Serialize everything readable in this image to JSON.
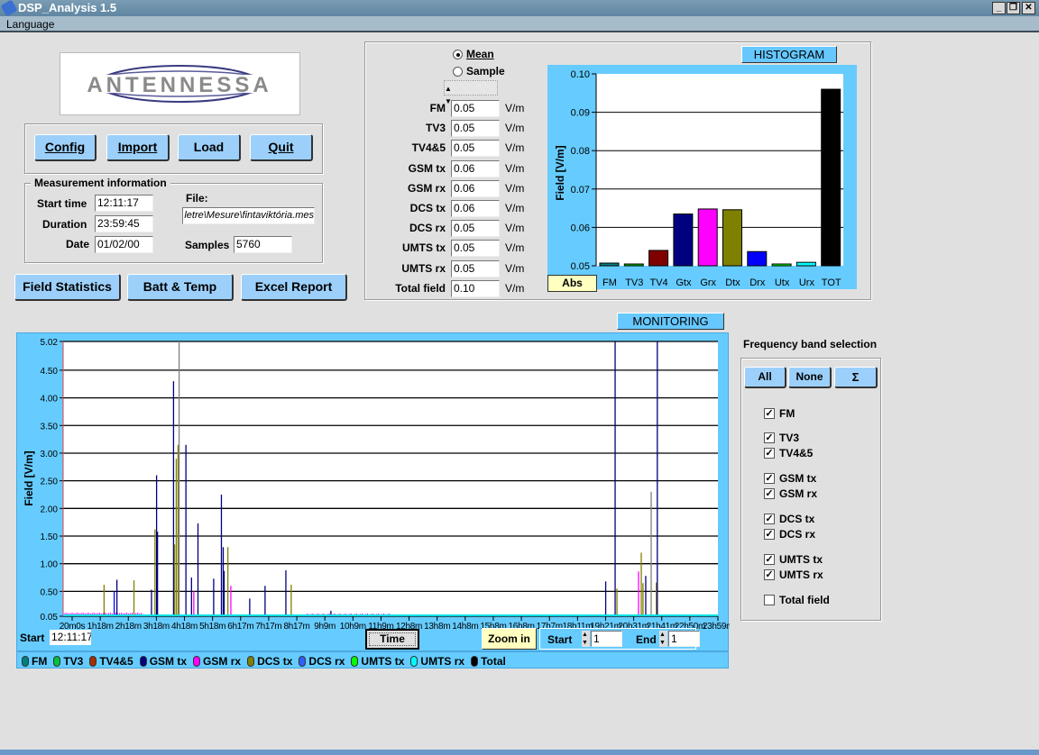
{
  "window": {
    "title": "DSP_Analysis 1.5",
    "menu": [
      "Language"
    ]
  },
  "logo": {
    "text": "ANTENNESSA"
  },
  "toolbar": {
    "config": "Config",
    "import": "Import",
    "load": "Load",
    "quit": "Quit"
  },
  "measurement": {
    "title": "Measurement information",
    "start_time_label": "Start time",
    "start_time": "12:11:17",
    "duration_label": "Duration",
    "duration": "23:59:45",
    "date_label": "Date",
    "date": "01/02/00",
    "file_label": "File:",
    "file": "letre\\Mesure\\fintaviktória.mes",
    "samples_label": "Samples",
    "samples": "5760"
  },
  "actions": {
    "field_statistics": "Field Statistics",
    "batt_temp": "Batt & Temp",
    "excel_report": "Excel Report"
  },
  "mode": {
    "mean": "Mean",
    "sample": "Sample",
    "selected": "Mean",
    "sample_spinner": ""
  },
  "bands": [
    {
      "label": "FM",
      "value": "0.05",
      "unit": "V/m"
    },
    {
      "label": "TV3",
      "value": "0.05",
      "unit": "V/m"
    },
    {
      "label": "TV4&5",
      "value": "0.05",
      "unit": "V/m"
    },
    {
      "label": "GSM tx",
      "value": "0.06",
      "unit": "V/m"
    },
    {
      "label": "GSM rx",
      "value": "0.06",
      "unit": "V/m"
    },
    {
      "label": "DCS tx",
      "value": "0.06",
      "unit": "V/m"
    },
    {
      "label": "DCS rx",
      "value": "0.05",
      "unit": "V/m"
    },
    {
      "label": "UMTS tx",
      "value": "0.05",
      "unit": "V/m"
    },
    {
      "label": "UMTS rx",
      "value": "0.05",
      "unit": "V/m"
    },
    {
      "label": "Total field",
      "value": "0.10",
      "unit": "V/m"
    }
  ],
  "histogram_title": "HISTOGRAM",
  "histogram_abs": "Abs",
  "monitoring_title": "MONITORING",
  "monitoring": {
    "start_label": "Start",
    "start_value": "12:11:17",
    "time_button": "Time",
    "zoom_in": "Zoom in",
    "range_start_label": "Start",
    "range_start": "1",
    "range_end_label": "End",
    "range_end": "1"
  },
  "freq_selection": {
    "title": "Frequency band selection",
    "all": "All",
    "none": "None",
    "sum": "Σ",
    "items": [
      {
        "label": "FM",
        "checked": true
      },
      {
        "label": "TV3",
        "checked": true
      },
      {
        "label": "TV4&5",
        "checked": true
      },
      {
        "label": "GSM tx",
        "checked": true
      },
      {
        "label": "GSM rx",
        "checked": true
      },
      {
        "label": "DCS tx",
        "checked": true
      },
      {
        "label": "DCS rx",
        "checked": true
      },
      {
        "label": "UMTS tx",
        "checked": true
      },
      {
        "label": "UMTS rx",
        "checked": true
      },
      {
        "label": "Total field",
        "checked": false
      }
    ]
  },
  "chart_data": [
    {
      "type": "bar",
      "ylabel": "Field [V/m]",
      "ylim": [
        0.05,
        0.1
      ],
      "yticks": [
        "0.10",
        "0.09",
        "0.08",
        "0.07",
        "0.06",
        "0.05"
      ],
      "grid": true,
      "categories": [
        "FM",
        "TV3",
        "TV4",
        "Gtx",
        "Grx",
        "Dtx",
        "Drx",
        "Utx",
        "Urx",
        "TOT"
      ],
      "values": [
        0.0507,
        0.05,
        0.054,
        0.0635,
        0.0648,
        0.0646,
        0.0537,
        0.0502,
        0.0509,
        0.096
      ],
      "colors": [
        "#008080",
        "#00c000",
        "#800000",
        "#000080",
        "#ff00ff",
        "#808000",
        "#0000ff",
        "#00ff00",
        "#00ffff",
        "#000000"
      ]
    },
    {
      "type": "line",
      "ylabel": "Field [V/m]",
      "ylim": [
        0.05,
        5.02
      ],
      "grid": true,
      "xlim_samples": [
        1,
        5760
      ],
      "yticks": [
        "5.02",
        "4.50",
        "4.00",
        "3.50",
        "3.00",
        "2.50",
        "2.00",
        "1.50",
        "1.00",
        "0.50",
        "0.05"
      ],
      "xticks": [
        "20m0s",
        "1h18m",
        "2h18m",
        "3h18m",
        "4h18m",
        "5h18m",
        "6h17m",
        "7h17m",
        "8h17m",
        "9h9m",
        "10h9m",
        "11h9m",
        "12h8m",
        "13h8m",
        "14h8m",
        "15h8m",
        "16h8m",
        "17h7m",
        "18h11m",
        "19h21m",
        "20h31m",
        "21h41m",
        "22h50m",
        "23h59m"
      ],
      "legend": [
        {
          "name": "FM",
          "color": "#008080"
        },
        {
          "name": "TV3",
          "color": "#00c040"
        },
        {
          "name": "TV4&5",
          "color": "#a03000"
        },
        {
          "name": "GSM tx",
          "color": "#000080"
        },
        {
          "name": "GSM rx",
          "color": "#ff00ff"
        },
        {
          "name": "DCS tx",
          "color": "#808000"
        },
        {
          "name": "DCS rx",
          "color": "#3060ff"
        },
        {
          "name": "UMTS tx",
          "color": "#00ff00"
        },
        {
          "name": "UMTS rx",
          "color": "#00ffff"
        },
        {
          "name": "Total",
          "color": "#000000"
        }
      ],
      "spikes": [
        {
          "s": 361,
          "v": 0.62,
          "c": "#808000"
        },
        {
          "s": 450,
          "v": 0.5,
          "c": "#0000ff"
        },
        {
          "s": 474,
          "v": 0.71,
          "c": "#000080"
        },
        {
          "s": 624,
          "v": 0.7,
          "c": "#808000"
        },
        {
          "s": 778,
          "v": 0.53,
          "c": "#000080"
        },
        {
          "s": 809,
          "v": 1.62,
          "c": "#808000"
        },
        {
          "s": 823,
          "v": 2.6,
          "c": "#000080"
        },
        {
          "s": 831,
          "v": 1.58,
          "c": "#000080"
        },
        {
          "s": 972,
          "v": 4.3,
          "c": "#000080"
        },
        {
          "s": 981,
          "v": 1.35,
          "c": "#808000"
        },
        {
          "s": 996,
          "v": 2.9,
          "c": "#808000"
        },
        {
          "s": 1012,
          "v": 3.15,
          "c": "#808000"
        },
        {
          "s": 1021,
          "v": 5.02,
          "c": "#808080"
        },
        {
          "s": 1081,
          "v": 3.15,
          "c": "#000080"
        },
        {
          "s": 1130,
          "v": 0.75,
          "c": "#000080"
        },
        {
          "s": 1150,
          "v": 0.5,
          "c": "#ff00ff"
        },
        {
          "s": 1187,
          "v": 1.73,
          "c": "#000080"
        },
        {
          "s": 1325,
          "v": 0.73,
          "c": "#000080"
        },
        {
          "s": 1393,
          "v": 2.25,
          "c": "#000080"
        },
        {
          "s": 1409,
          "v": 1.3,
          "c": "#000080"
        },
        {
          "s": 1417,
          "v": 0.87,
          "c": "#000080"
        },
        {
          "s": 1450,
          "v": 1.3,
          "c": "#808000"
        },
        {
          "s": 1476,
          "v": 0.6,
          "c": "#ff00ff"
        },
        {
          "s": 1642,
          "v": 0.37,
          "c": "#000080"
        },
        {
          "s": 1777,
          "v": 0.6,
          "c": "#000080"
        },
        {
          "s": 1960,
          "v": 0.88,
          "c": "#000080"
        },
        {
          "s": 2007,
          "v": 0.62,
          "c": "#808000"
        },
        {
          "s": 2356,
          "v": 0.15,
          "c": "#000080"
        },
        {
          "s": 4773,
          "v": 0.68,
          "c": "#000080"
        },
        {
          "s": 4856,
          "v": 5.02,
          "c": "#000080"
        },
        {
          "s": 4872,
          "v": 0.55,
          "c": "#808000"
        },
        {
          "s": 5062,
          "v": 0.86,
          "c": "#ff00ff"
        },
        {
          "s": 5086,
          "v": 1.2,
          "c": "#808000"
        },
        {
          "s": 5101,
          "v": 0.65,
          "c": "#808000"
        },
        {
          "s": 5125,
          "v": 0.78,
          "c": "#000080"
        },
        {
          "s": 5173,
          "v": 2.3,
          "c": "#808080"
        },
        {
          "s": 5218,
          "v": 0.66,
          "c": "#808000"
        },
        {
          "s": 5227,
          "v": 5.02,
          "c": "#000080"
        }
      ],
      "bands": [
        {
          "from": 2150,
          "to": 2880,
          "v": 0.08,
          "c": "#ff00ff"
        },
        {
          "from": 1,
          "to": 700,
          "v": 0.1,
          "c": "#ff00ff"
        }
      ]
    }
  ]
}
